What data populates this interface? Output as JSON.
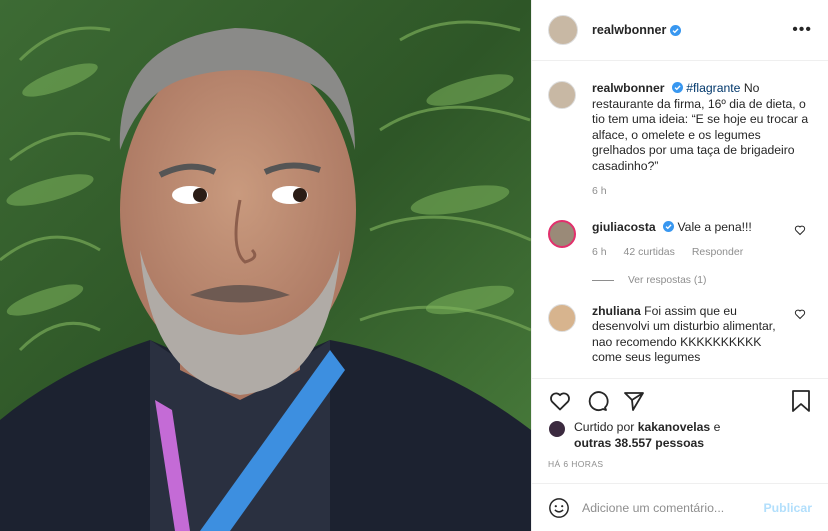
{
  "post": {
    "username": "realwbonner",
    "verified": true,
    "more_icon": "more-horizontal-icon"
  },
  "caption": {
    "username": "realwbonner",
    "hashtag": "#flagrante",
    "text": "No restaurante da firma, 16º dia de dieta, o tio tem uma ideia: “E se hoje eu trocar a alface, o omelete e os legumes grelhados por uma taça de brigadeiro casadinho?”",
    "time": "6 h"
  },
  "comments": [
    {
      "username": "giuliacosta",
      "verified": true,
      "text": "Vale a pena!!!",
      "time": "6 h",
      "likes": "42 curtidas",
      "reply_label": "Responder",
      "view_replies": "Ver respostas (1)"
    },
    {
      "username": "zhuliana",
      "verified": false,
      "text": "Foi assim que eu desenvolvi um disturbio alimentar, nao recomendo KKKKKKKKKK come seus legumes"
    }
  ],
  "likes": {
    "prefix": "Curtido por",
    "user": "kakanovelas",
    "conj": "e",
    "others": "outras 38.557 pessoas"
  },
  "timestamp": "HÁ 6 HORAS",
  "add_comment": {
    "placeholder": "Adicione um comentário...",
    "publish": "Publicar"
  },
  "colors": {
    "verified": "#3897f0",
    "link": "#00376b",
    "publish_disabled": "#b2dffc",
    "muted": "#8e8e8e"
  }
}
